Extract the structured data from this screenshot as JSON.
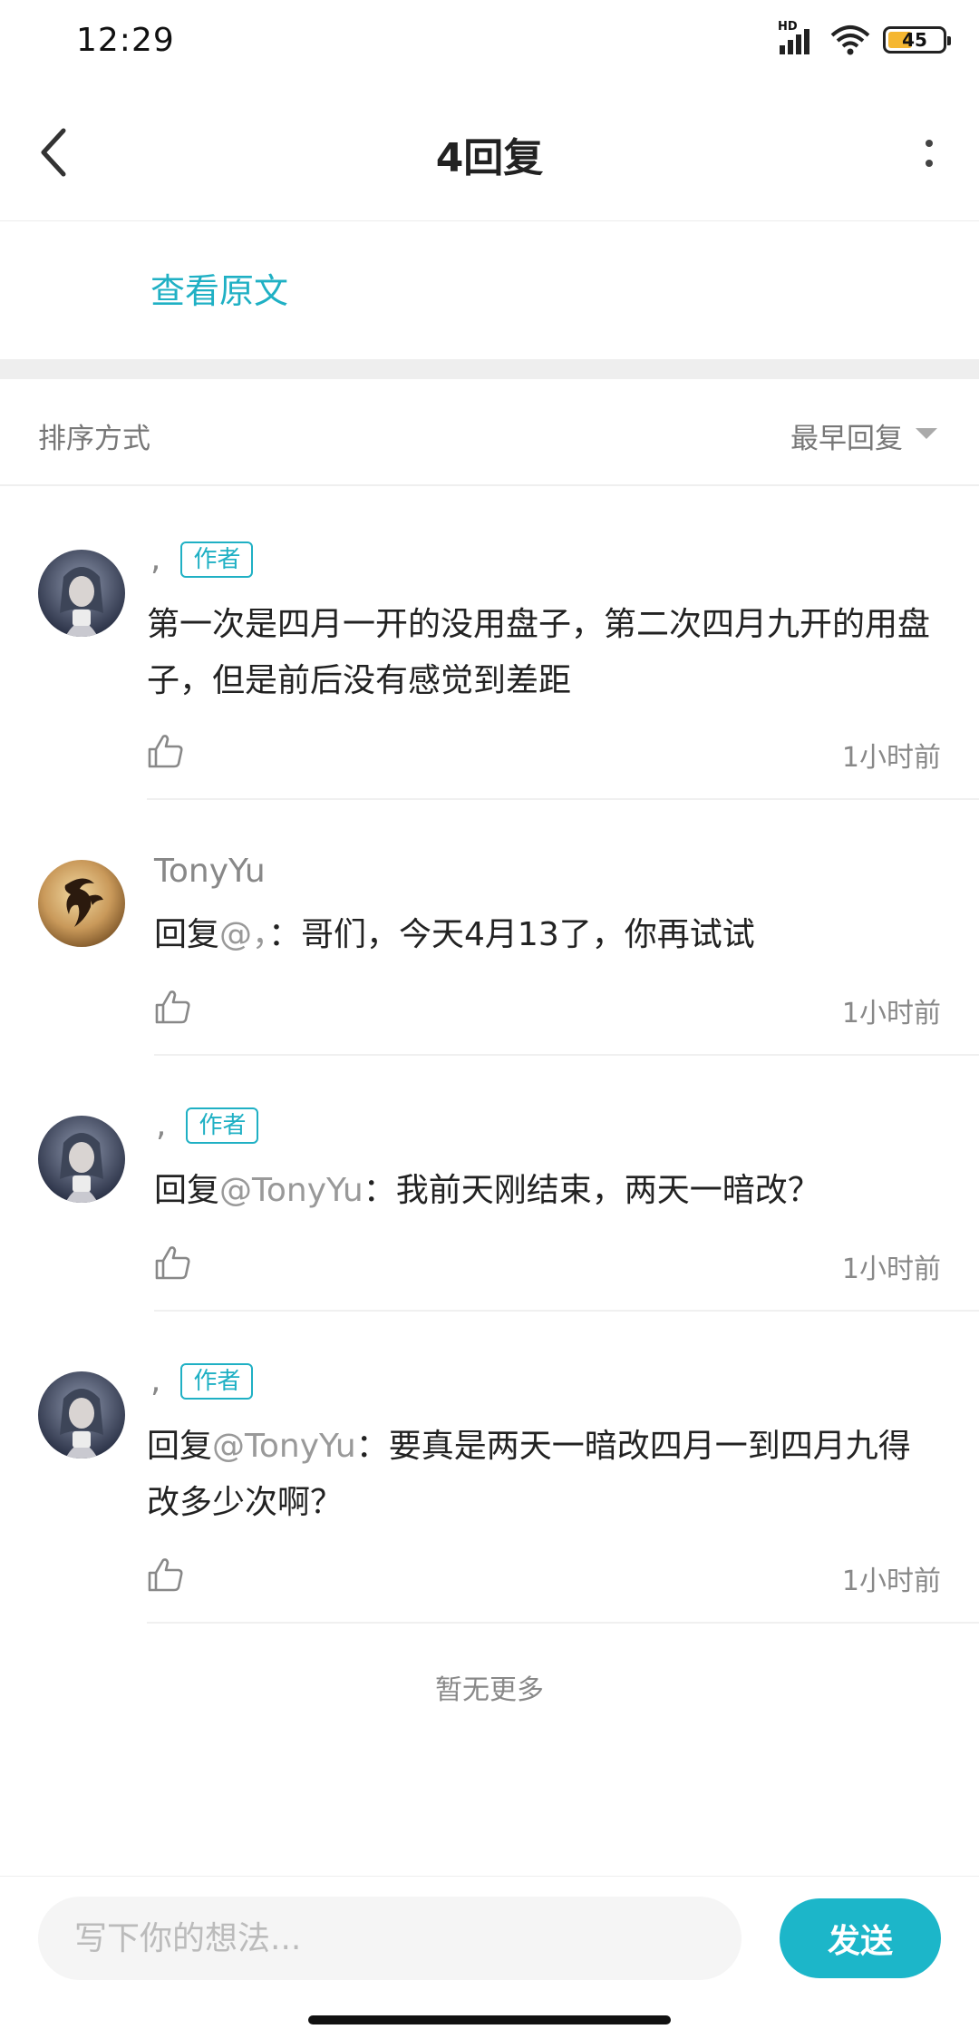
{
  "status_bar": {
    "time": "12:29",
    "hd": "HD",
    "battery": "45",
    "battery_level": 0.45,
    "colors": {
      "battery_fill": "#f5b731"
    }
  },
  "header": {
    "title": "4回复",
    "back_icon": "chevron-left-icon",
    "more_icon": "more-vertical-icon"
  },
  "original_link": "查看原文",
  "sort": {
    "label": "排序方式",
    "value": "最早回复"
  },
  "accent_color": "#1fb0c4",
  "comments": [
    {
      "author": ",",
      "badge": "作者",
      "text": "第一次是四月一开的没用盘子，第二次四月九开的用盘子，但是前后没有感觉到差距",
      "time": "1小时前",
      "avatar": "anime-girl-avatar"
    },
    {
      "author": "TonyYu",
      "reply_prefix": "回复",
      "mention": "@，",
      "text": "：哥们，今天4月13了，你再试试",
      "time": "1小时前",
      "avatar": "fairy-tail-emblem-avatar"
    },
    {
      "author": ",",
      "badge": "作者",
      "reply_prefix": "回复",
      "mention": "@TonyYu",
      "text": "：我前天刚结束，两天一暗改？",
      "time": "1小时前",
      "avatar": "anime-girl-avatar"
    },
    {
      "author": ",",
      "badge": "作者",
      "reply_prefix": "回复",
      "mention": "@TonyYu",
      "text": "：要真是两天一暗改四月一到四月九得改多少次啊？",
      "time": "1小时前",
      "avatar": "anime-girl-avatar"
    }
  ],
  "no_more": "暂无更多",
  "input": {
    "placeholder": "写下你的想法...",
    "value": ""
  },
  "send_label": "发送",
  "colors": {
    "send_button": "#1cb6c9",
    "mention": "#999999"
  }
}
